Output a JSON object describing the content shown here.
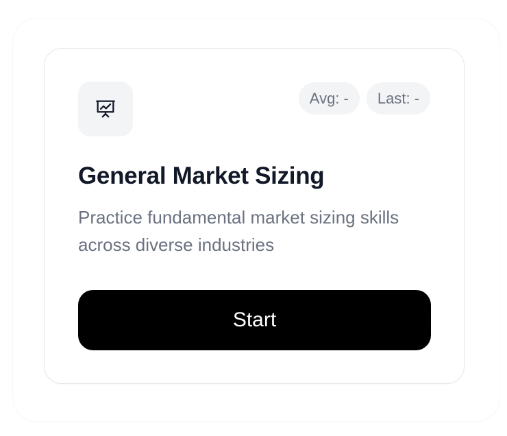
{
  "card": {
    "icon": "presentation-chart-icon",
    "badges": {
      "avg": "Avg: -",
      "last": "Last: -"
    },
    "title": "General Market Sizing",
    "description": "Practice fundamental market sizing skills across diverse industries",
    "start_label": "Start"
  },
  "colors": {
    "button_bg": "#000000",
    "badge_bg": "#f3f4f6",
    "title": "#111827",
    "muted_text": "#6b7280",
    "border": "#e5e7eb"
  }
}
